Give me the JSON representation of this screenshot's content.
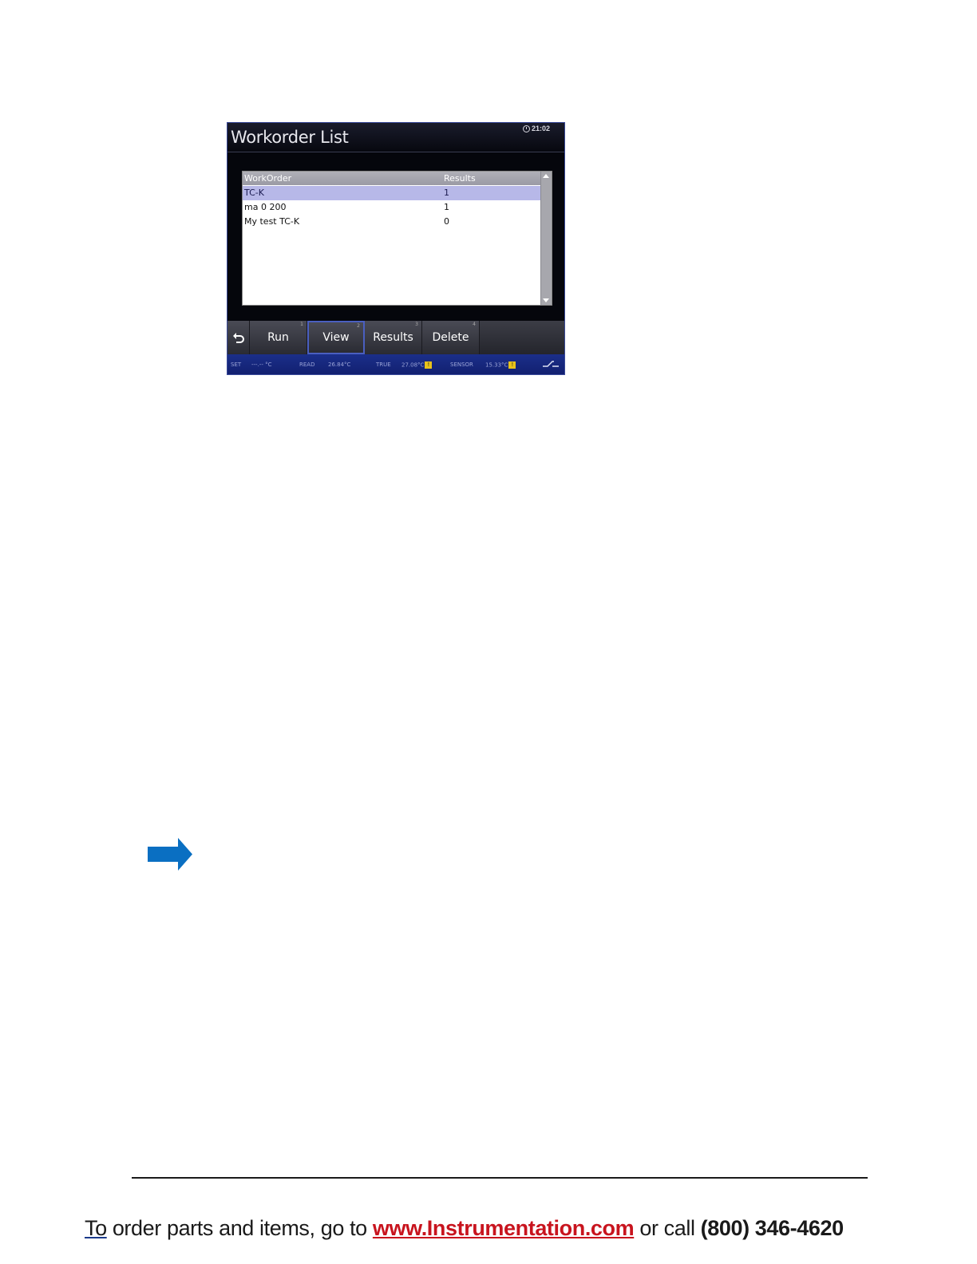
{
  "device": {
    "title": "Workorder List",
    "clock": "21:02",
    "list": {
      "headers": [
        "WorkOrder",
        "Results"
      ],
      "rows": [
        {
          "name": "TC-K",
          "results": "1",
          "selected": true
        },
        {
          "name": "ma 0 200",
          "results": "1",
          "selected": false
        },
        {
          "name": "My test TC-K",
          "results": "0",
          "selected": false
        }
      ]
    },
    "softkeys": [
      {
        "label": "",
        "icon": "back-arrow-icon"
      },
      {
        "label": "Run",
        "num": "1"
      },
      {
        "label": "View",
        "num": "2",
        "active": true
      },
      {
        "label": "Results",
        "num": "3"
      },
      {
        "label": "Delete",
        "num": "4"
      }
    ],
    "status": {
      "set_label": "SET",
      "set_value": "---.-- °C",
      "read_label": "READ",
      "read_value": "26.84°C",
      "true_label": "TRUE",
      "true_value": "27.08°C",
      "sensor_label": "SENSOR",
      "sensor_value": "15.33°C",
      "warn_mark": "!"
    },
    "colors": {
      "selected_row": "#b7b8e8",
      "status_bar": "#1b2f8a",
      "warning": "#e8c21a"
    }
  },
  "page": {
    "arrow_color": "#0a6fc2",
    "footer": {
      "prefix_u": "To",
      "prefix": " order parts and items, go to ",
      "link": "www.Instrumentation.com",
      "middle": " or call ",
      "phone": "(800) 346-4620",
      "link_color": "#c8141e"
    }
  }
}
